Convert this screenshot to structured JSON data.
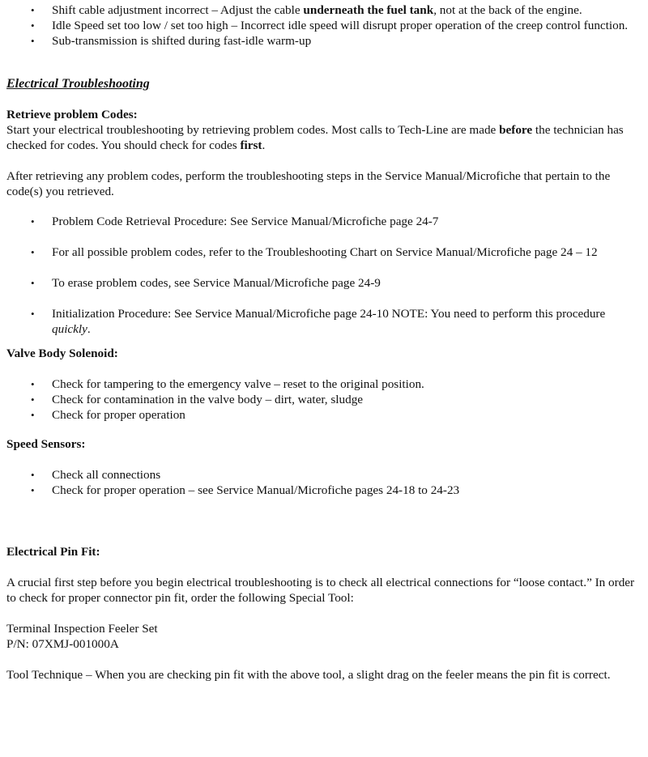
{
  "intro_bullets": [
    {
      "pre": "Shift cable adjustment incorrect – Adjust the cable ",
      "bold": "underneath the fuel tank",
      "post": ", not at the back of the engine."
    },
    {
      "text": "Idle Speed set too low / set too high – Incorrect idle speed will disrupt proper operation of the creep control function."
    },
    {
      "text": "Sub-transmission is shifted during fast-idle warm-up"
    }
  ],
  "section_title": "Electrical Troubleshooting",
  "retrieve": {
    "heading": "Retrieve problem Codes:",
    "p1_a": "Start your electrical troubleshooting by retrieving problem codes.  Most calls to Tech-Line are made ",
    "p1_b": "before",
    "p1_c": " the technician has checked for codes.  You should check for codes ",
    "p1_d": "first",
    "p1_e": ".",
    "p2": "After retrieving any problem codes, perform the troubleshooting steps in the Service Manual/Microfiche that pertain to the code(s) you retrieved.",
    "bullets": [
      "Problem Code Retrieval Procedure:  See Service Manual/Microfiche page 24-7",
      "For all possible problem codes, refer to the Troubleshooting Chart on Service Manual/Microfiche page 24 – 12",
      "To erase problem codes, see Service Manual/Microfiche page 24-9"
    ],
    "init_a": "Initialization Procedure:  See Service Manual/Microfiche page 24-10  NOTE:  You need to perform this procedure ",
    "init_b": "quickly",
    "init_c": "."
  },
  "valve": {
    "heading": "Valve Body Solenoid:",
    "bullets": [
      "Check for tampering to the emergency valve – reset to the original position.",
      "Check for contamination in the valve body – dirt, water, sludge",
      "Check for proper operation"
    ]
  },
  "speed": {
    "heading": "Speed Sensors:",
    "bullets": [
      "Check all connections",
      "Check for proper operation – see Service Manual/Microfiche pages 24-18 to 24-23"
    ]
  },
  "pinfit": {
    "heading": "Electrical Pin Fit:",
    "p1": "A crucial first step before you begin electrical troubleshooting is to check all electrical connections for “loose contact.”  In order to check for proper connector pin fit, order the following Special Tool:",
    "tool_name": "Terminal Inspection Feeler Set",
    "part_number": "P/N:  07XMJ-001000A",
    "p2": "Tool Technique – When you are checking pin fit with the above tool, a slight drag on the feeler means the pin fit is correct."
  },
  "bullet_glyph": "•"
}
